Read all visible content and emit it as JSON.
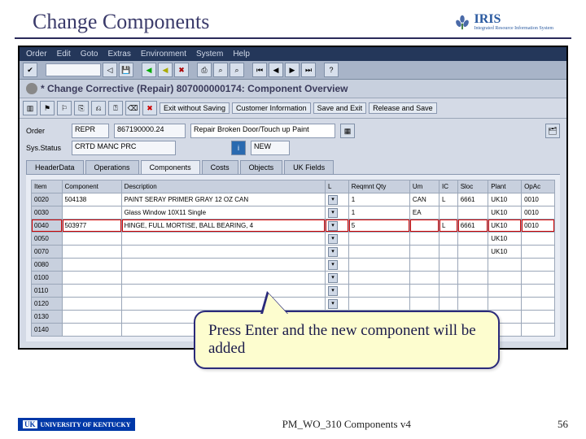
{
  "slide": {
    "title": "Change Components",
    "footer_center": "PM_WO_310 Components v4",
    "page_number": "56",
    "uk_text": "UNIVERSITY OF KENTUCKY"
  },
  "iris": {
    "big": "IRIS",
    "small": "Integrated Resource Information System"
  },
  "menubar": [
    "Order",
    "Edit",
    "Goto",
    "Extras",
    "Environment",
    "System",
    "Help"
  ],
  "page_title": "* Change Corrective  (Repair) 807000000174: Component Overview",
  "app_buttons": {
    "exit_wo_saving": "Exit without Saving",
    "customer_info": "Customer Information",
    "save_and_exit": "Save and Exit",
    "release_and_save": "Release and Save"
  },
  "form": {
    "order_label": "Order",
    "order_type": "REPR",
    "order_no": "867190000.24",
    "order_desc": "Repair Broken Door/Touch up Paint",
    "sysstatus_label": "Sys.Status",
    "sysstatus": "CRTD MANC PRC",
    "new_label": "NEW"
  },
  "tabs": [
    "HeaderData",
    "Operations",
    "Components",
    "Costs",
    "Objects",
    "UK Fields"
  ],
  "grid": {
    "headers": [
      "Item",
      "Component",
      "Description",
      "L",
      "Reqmnt Qty",
      "Um",
      "IC",
      "Sloc",
      "Plant",
      "OpAc"
    ],
    "rows": [
      {
        "item": "0020",
        "comp": "504138",
        "desc": "PAINT SERAY PRIMER GRAY 12 OZ CAN",
        "qty": "1",
        "um": "CAN",
        "ic": "L",
        "sloc": "6661",
        "plant": "UK10",
        "opac": "0010"
      },
      {
        "item": "0030",
        "comp": "",
        "desc": "Glass Window 10X11 Single",
        "qty": "1",
        "um": "EA",
        "ic": "",
        "sloc": "",
        "plant": "UK10",
        "opac": "0010"
      },
      {
        "item": "0040",
        "comp": "503977",
        "desc": "HINGE, FULL MORTISE, BALL BEARING, 4",
        "qty": "5",
        "um": "",
        "ic": "L",
        "sloc": "6661",
        "plant": "UK10",
        "opac": "0010",
        "highlight": true
      },
      {
        "item": "0050",
        "comp": "",
        "desc": "",
        "qty": "",
        "um": "",
        "ic": "",
        "sloc": "",
        "plant": "UK10",
        "opac": ""
      },
      {
        "item": "0070",
        "comp": "",
        "desc": "",
        "qty": "",
        "um": "",
        "ic": "",
        "sloc": "",
        "plant": "UK10",
        "opac": ""
      },
      {
        "item": "0080",
        "comp": "",
        "desc": "",
        "qty": "",
        "um": "",
        "ic": "",
        "sloc": "",
        "plant": "",
        "opac": ""
      },
      {
        "item": "0100",
        "comp": "",
        "desc": "",
        "qty": "",
        "um": "",
        "ic": "",
        "sloc": "",
        "plant": "",
        "opac": ""
      },
      {
        "item": "0110",
        "comp": "",
        "desc": "",
        "qty": "",
        "um": "",
        "ic": "",
        "sloc": "",
        "plant": "",
        "opac": ""
      },
      {
        "item": "0120",
        "comp": "",
        "desc": "",
        "qty": "",
        "um": "",
        "ic": "",
        "sloc": "",
        "plant": "",
        "opac": ""
      },
      {
        "item": "0130",
        "comp": "",
        "desc": "",
        "qty": "",
        "um": "",
        "ic": "",
        "sloc": "",
        "plant": "",
        "opac": ""
      },
      {
        "item": "0140",
        "comp": "",
        "desc": "",
        "qty": "",
        "um": "",
        "ic": "",
        "sloc": "",
        "plant": "",
        "opac": ""
      }
    ]
  },
  "callout": "Press Enter and the new component will be added"
}
